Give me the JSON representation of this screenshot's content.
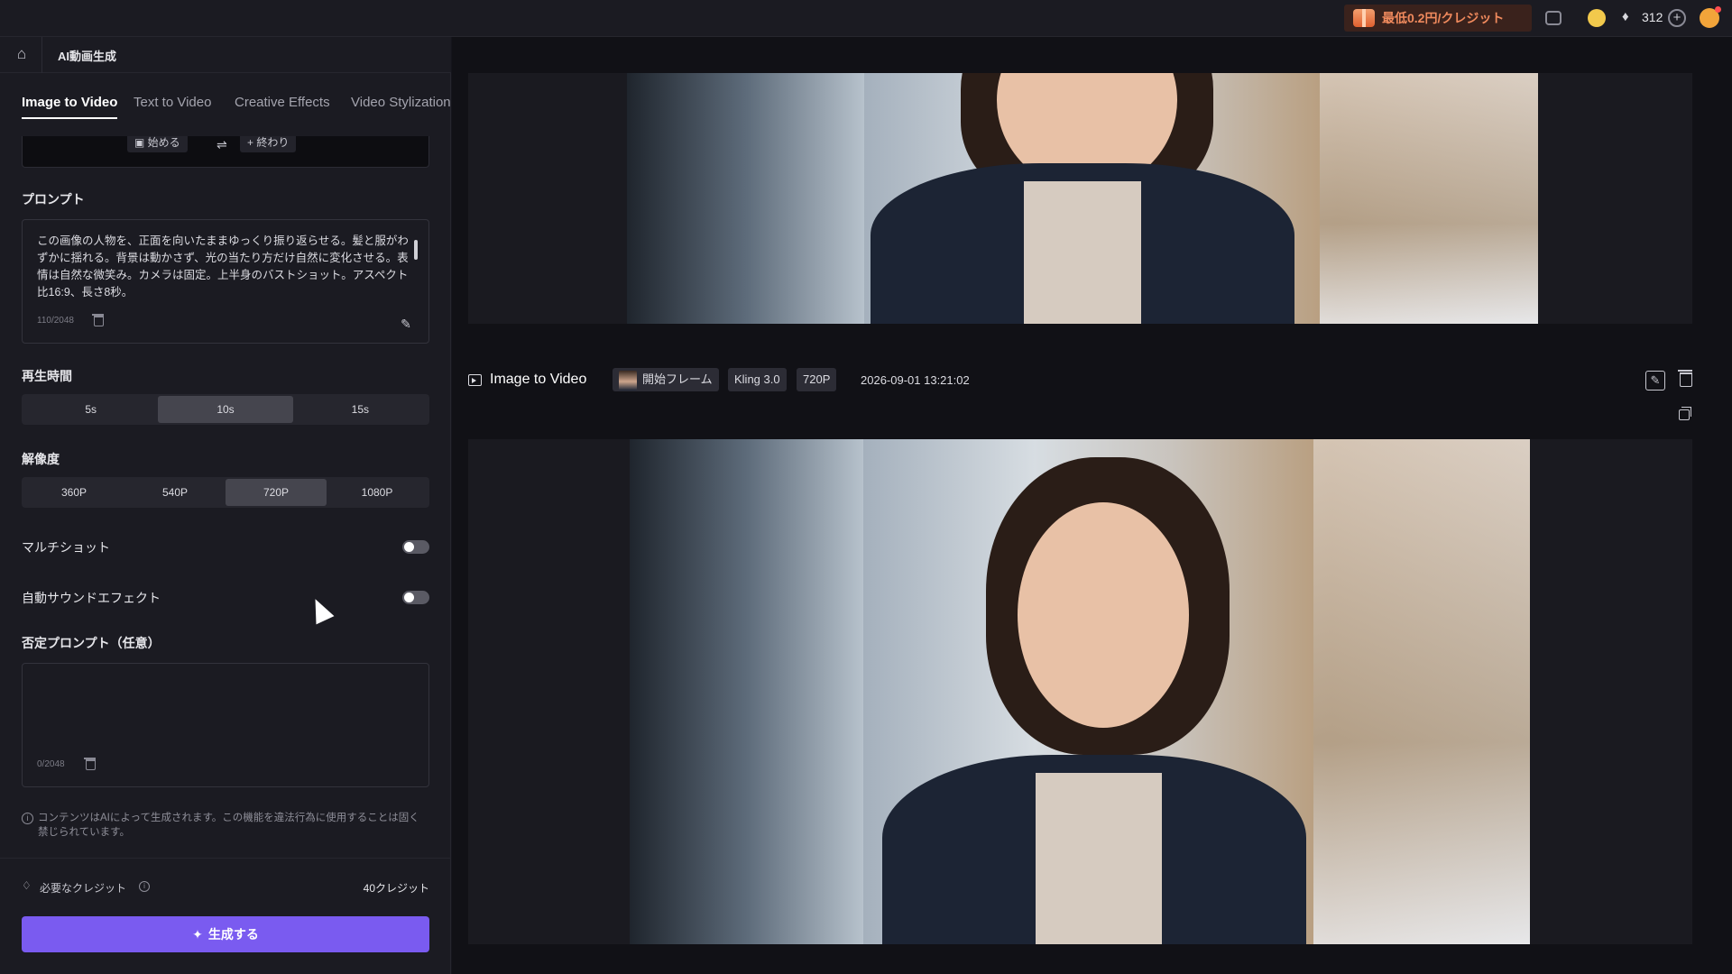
{
  "topbar": {
    "promo_text": "最低0.2円/クレジット",
    "credits": "312",
    "icons": [
      "gift-icon",
      "message-icon",
      "coin-icon",
      "gem-icon",
      "plus-icon",
      "avatar"
    ]
  },
  "subbar": {
    "app_title": "AI動画生成"
  },
  "tabs": [
    {
      "label": "Image to Video",
      "active": true
    },
    {
      "label": "Text to Video",
      "active": false
    },
    {
      "label": "Creative Effects",
      "active": false
    },
    {
      "label": "Video Stylization",
      "active": false
    }
  ],
  "frames": {
    "start_label": "始める",
    "end_label": "終わり"
  },
  "prompt": {
    "label": "プロンプト",
    "text": "この画像の人物を、正面を向いたままゆっくり振り返らせる。髪と服がわずかに揺れる。背景は動かさず、光の当たり方だけ自然に変化させる。表情は自然な微笑み。カメラは固定。上半身のバストショット。アスペクト比16:9、長さ8秒。",
    "counter": "110/2048"
  },
  "duration": {
    "label": "再生時間",
    "options": [
      "5s",
      "10s",
      "15s"
    ],
    "selected": "10s"
  },
  "resolution": {
    "label": "解像度",
    "options": [
      "360P",
      "540P",
      "720P",
      "1080P"
    ],
    "selected": "720P"
  },
  "toggles": {
    "multishot_label": "マルチショット",
    "multishot_on": false,
    "auto_sound_label": "自動サウンドエフェクト",
    "auto_sound_on": false
  },
  "negative_prompt": {
    "label": "否定プロンプト（任意）",
    "text": "",
    "counter": "0/2048"
  },
  "notice": "コンテンツはAIによって生成されます。この機能を違法行為に使用することは固く禁じられています。",
  "footer": {
    "required_label": "必要なクレジット",
    "required_value": "40クレジット",
    "generate_label": "生成する"
  },
  "result": {
    "title": "Image to Video",
    "chips": [
      "開始フレーム",
      "Kling 3.0",
      "720P"
    ],
    "timestamp": "2026-09-01 13:21:02"
  },
  "colors": {
    "accent": "#7a5bf0",
    "background": "#15151c",
    "panel": "#1b1b22",
    "promo": "#f08a5d"
  }
}
